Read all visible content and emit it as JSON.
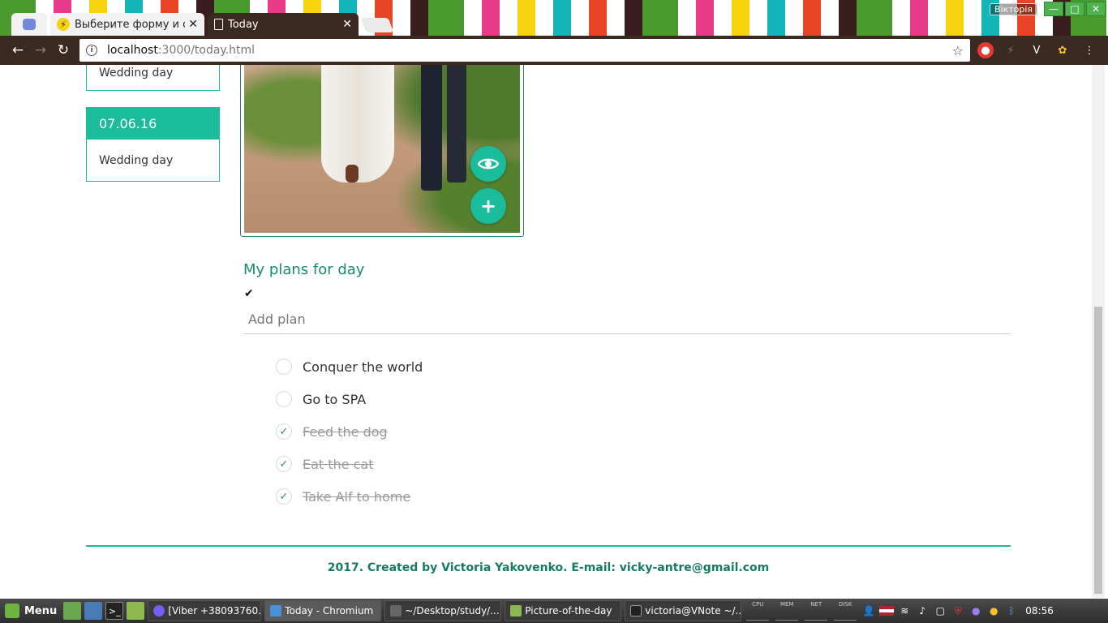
{
  "browser": {
    "tabs": [
      {
        "title": "",
        "icon": "discord-icon"
      },
      {
        "title": "Выберите форму и об",
        "icon": "bolt-icon"
      },
      {
        "title": "Today",
        "icon": "page-icon"
      }
    ],
    "user_name": "Віктopiя",
    "url_host": "localhost",
    "url_rest": ":3000/today.html"
  },
  "sidebar": {
    "cards": [
      {
        "date": "",
        "title": "Wedding day"
      },
      {
        "date": "07.06.16",
        "title": "Wedding day"
      }
    ]
  },
  "photo": {
    "view_icon": "eye-icon",
    "add_label": "+"
  },
  "plans": {
    "heading": "My plans for day",
    "check_symbol": "✔",
    "input_placeholder": "Add plan",
    "items": [
      {
        "label": "Conquer the world",
        "done": false
      },
      {
        "label": "Go to SPA",
        "done": false
      },
      {
        "label": "Feed the dog",
        "done": true
      },
      {
        "label": "Eat the cat",
        "done": true
      },
      {
        "label": "Take Alf to home",
        "done": true
      }
    ],
    "done_mark": "✓"
  },
  "footer": {
    "text": "2017. Created by Victoria Yakovenko. E-mail: vicky-antre@gmail.com"
  },
  "taskbar": {
    "menu_label": "Menu",
    "tasks": [
      {
        "label": "[Viber +38093760..."
      },
      {
        "label": "Today - Chromium"
      },
      {
        "label": "~/Desktop/study/..."
      },
      {
        "label": "Picture-of-the-day"
      },
      {
        "label": "victoria@VNote ~/..."
      }
    ],
    "monitors": [
      "CPU",
      "MEM",
      "NET",
      "DISK"
    ],
    "clock": "08:56"
  },
  "colors": {
    "accent": "#1abc9c",
    "heading": "#1a8a6e",
    "footer_text": "#177b62",
    "browser_frame": "#3b2a22"
  }
}
